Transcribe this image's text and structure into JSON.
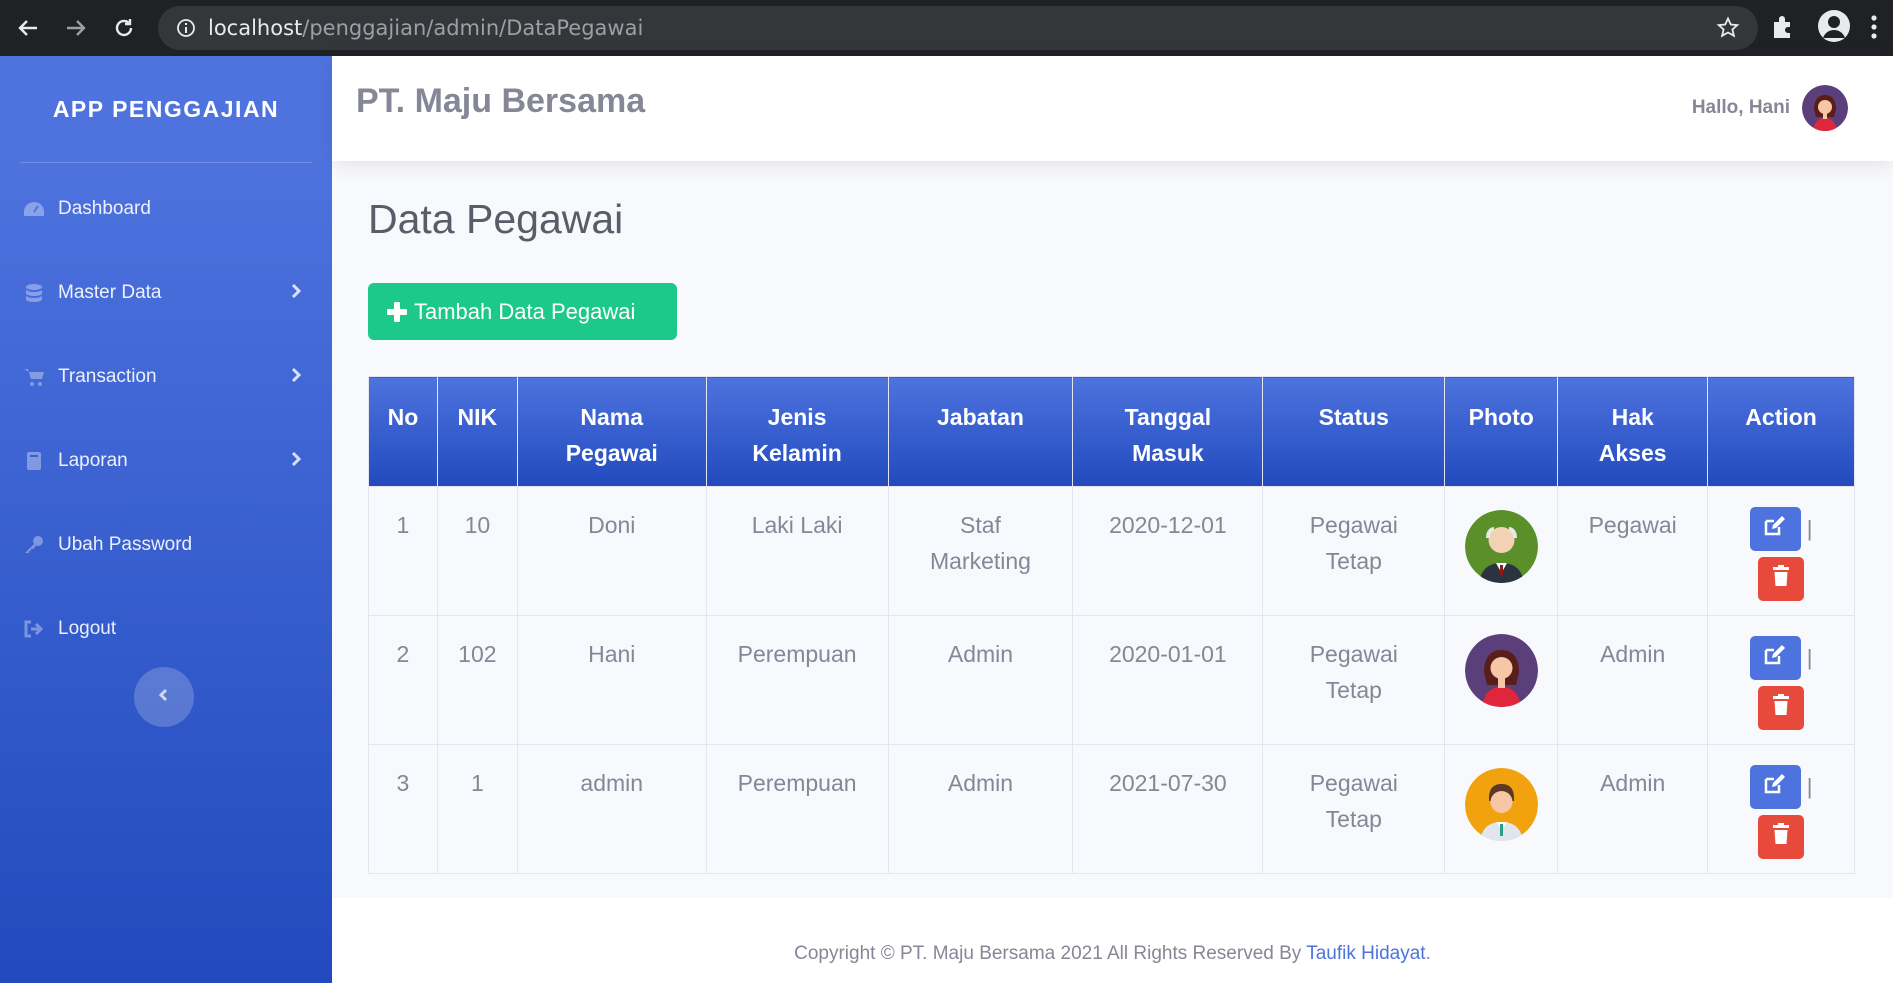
{
  "browser": {
    "url_host": "localhost",
    "url_path": "/penggajian/admin/DataPegawai"
  },
  "sidebar": {
    "brand": "APP PENGGAJIAN",
    "items": [
      {
        "label": "Dashboard",
        "icon": "dashboard-icon"
      },
      {
        "label": "Master Data",
        "icon": "database-icon"
      },
      {
        "label": "Transaction",
        "icon": "cart-icon"
      },
      {
        "label": "Laporan",
        "icon": "book-icon"
      },
      {
        "label": "Ubah Password",
        "icon": "key-icon"
      },
      {
        "label": "Logout",
        "icon": "logout-icon"
      }
    ]
  },
  "topbar": {
    "company": "PT. Maju Bersama",
    "greeting": "Hallo, Hani"
  },
  "main": {
    "title": "Data Pegawai",
    "add_button": "Tambah Data Pegawai"
  },
  "table": {
    "headers": [
      "No",
      "NIK",
      "Nama Pegawai",
      "Jenis Kelamin",
      "Jabatan",
      "Tanggal Masuk",
      "Status",
      "Photo",
      "Hak Akses",
      "Action"
    ],
    "rows": [
      {
        "no": "1",
        "nik": "10",
        "nama": "Doni",
        "jk": "Laki Laki",
        "jabatan": "Staf Marketing",
        "tanggal": "2020-12-01",
        "status": "Pegawai Tetap",
        "hak": "Pegawai",
        "photo": "old-man-avatar"
      },
      {
        "no": "2",
        "nik": "102",
        "nama": "Hani",
        "jk": "Perempuan",
        "jabatan": "Admin",
        "tanggal": "2020-01-01",
        "status": "Pegawai Tetap",
        "hak": "Admin",
        "photo": "woman-avatar"
      },
      {
        "no": "3",
        "nik": "1",
        "nama": "admin",
        "jk": "Perempuan",
        "jabatan": "Admin",
        "tanggal": "2021-07-30",
        "status": "Pegawai Tetap",
        "hak": "Admin",
        "photo": "man-avatar"
      }
    ],
    "separator": "|"
  },
  "footer": {
    "text": "Copyright © PT. Maju Bersama 2021 All Rights Reserved By",
    "author": "Taufik Hidayat",
    "end": "."
  },
  "colors": {
    "primary": "#4e73df",
    "success": "#1cc88a",
    "danger": "#e74a3b",
    "text": "#858796"
  }
}
